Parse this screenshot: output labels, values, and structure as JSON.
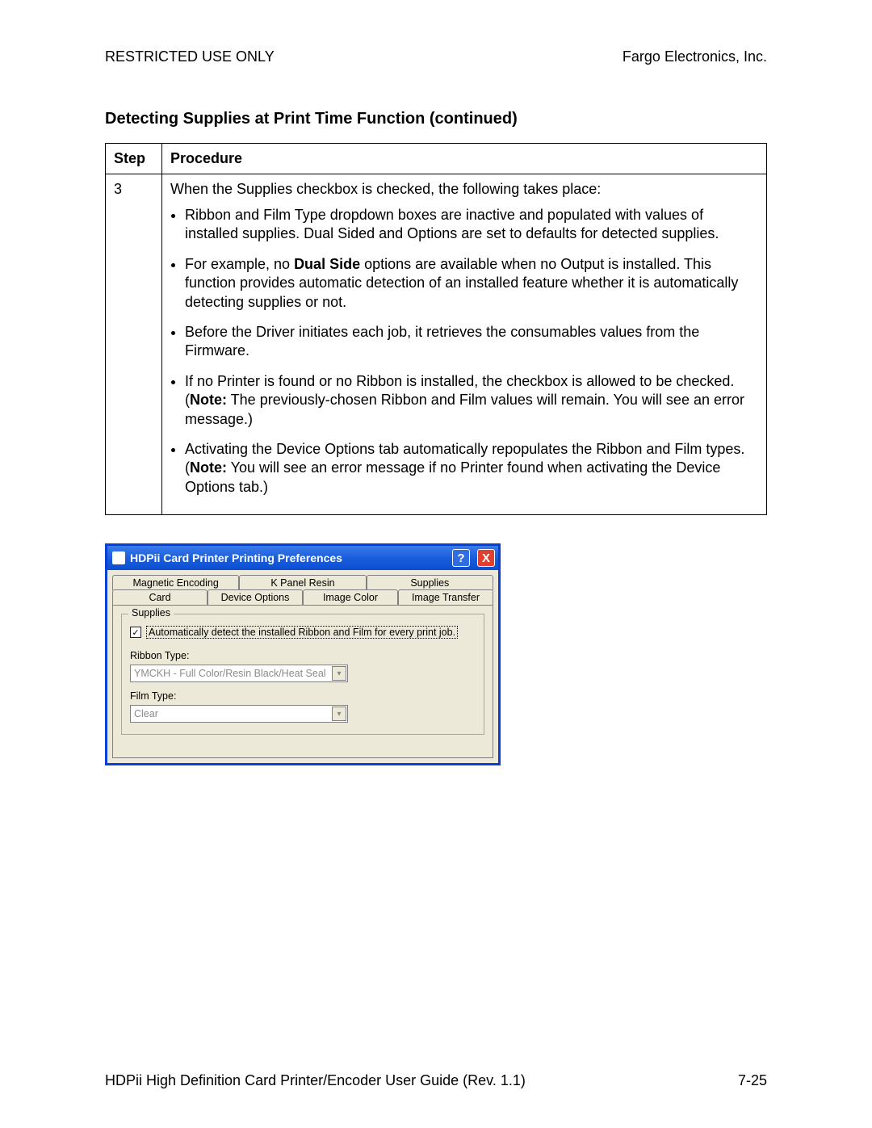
{
  "header": {
    "left": "RESTRICTED USE ONLY",
    "right": "Fargo Electronics, Inc."
  },
  "section_title": "Detecting Supplies at Print Time Function (continued)",
  "table": {
    "col_step": "Step",
    "col_proc": "Procedure",
    "step": "3",
    "intro": "When the Supplies checkbox is checked, the following takes place:",
    "b1": "Ribbon and Film Type dropdown boxes are inactive and populated with values of installed supplies. Dual Sided and Options are set to defaults for detected supplies.",
    "b2_pre": "For example, no ",
    "b2_bold": "Dual Side",
    "b2_post": " options are available when no Output is installed. This function provides automatic detection of an installed feature whether it is automatically detecting supplies or not.",
    "b3": "Before the Driver initiates each job, it retrieves the consumables values from the Firmware.",
    "b4_pre": "If no Printer is found or no Ribbon is installed, the checkbox is allowed to be checked. (",
    "b4_bold": "Note:",
    "b4_post": "  The previously-chosen Ribbon and Film values will remain. You will see an error message.)",
    "b5_pre": "Activating the Device Options tab automatically repopulates the Ribbon and Film types. (",
    "b5_bold": "Note:",
    "b5_post": "  You will see an error message if no Printer found when activating the Device Options tab.)"
  },
  "dialog": {
    "title": "HDPii Card Printer Printing Preferences",
    "help": "?",
    "close": "X",
    "tabs_row1": [
      "Magnetic Encoding",
      "K Panel Resin",
      "Supplies"
    ],
    "tabs_row2": [
      "Card",
      "Device Options",
      "Image Color",
      "Image Transfer"
    ],
    "group_title": "Supplies",
    "checkbox_label": "Automatically detect the installed Ribbon and Film for every print job.",
    "ribbon_label": "Ribbon Type:",
    "ribbon_value": "YMCKH - Full Color/Resin Black/Heat Seal",
    "film_label": "Film Type:",
    "film_value": "Clear"
  },
  "footer": {
    "left": "HDPii High Definition Card Printer/Encoder User Guide (Rev. 1.1)",
    "right": "7-25"
  }
}
